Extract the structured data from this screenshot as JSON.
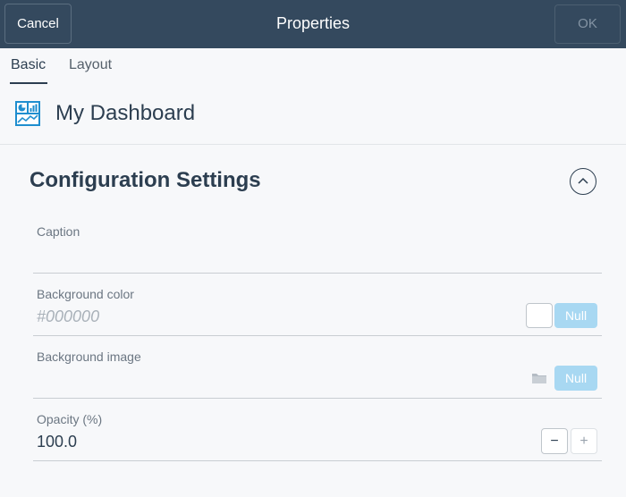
{
  "header": {
    "cancel_label": "Cancel",
    "title": "Properties",
    "ok_label": "OK"
  },
  "tabs": [
    {
      "label": "Basic",
      "active": true
    },
    {
      "label": "Layout",
      "active": false
    }
  ],
  "dashboard": {
    "icon": "dashboard-icon",
    "name": "My Dashboard"
  },
  "section": {
    "title": "Configuration Settings",
    "collapse_icon": "chevron-up-icon"
  },
  "fields": {
    "caption": {
      "label": "Caption",
      "value": ""
    },
    "background_color": {
      "label": "Background color",
      "placeholder": "#000000",
      "swatch_color": "#ffffff",
      "null_label": "Null"
    },
    "background_image": {
      "label": "Background image",
      "icon": "folder-icon",
      "null_label": "Null"
    },
    "opacity": {
      "label": "Opacity (%)",
      "value": "100.0",
      "minus_label": "−",
      "plus_label": "+"
    }
  },
  "colors": {
    "header_bg": "#34495e",
    "accent_null": "#a8d8f2",
    "text_primary": "#2c3e50",
    "icon_blue": "#1f8ecf"
  }
}
